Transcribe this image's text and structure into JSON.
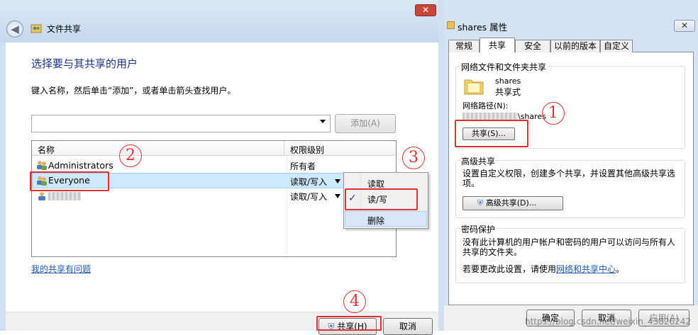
{
  "left_window": {
    "title": "文件共享",
    "close_glyph": "✕",
    "heading": "选择要与其共享的用户",
    "instruction": "键入名称，然后单击“添加”，或者单击箭头查找用户。",
    "add_button": "添加(A)",
    "columns": {
      "name": "名称",
      "permission": "权限级别"
    },
    "rows": [
      {
        "name": "Administrators",
        "permission": "所有者"
      },
      {
        "name": "Everyone",
        "permission": "读取/写入"
      },
      {
        "name": "",
        "permission": "读取/写入"
      }
    ],
    "context_menu": {
      "items": [
        "读取",
        "读/写",
        "删除"
      ],
      "checked": "读/写"
    },
    "problem_link": "我的共享有问题",
    "share_button": "共享(H)",
    "cancel_button": "取消"
  },
  "right_window": {
    "title": "shares 属性",
    "close_glyph": "✕",
    "tabs": [
      "常规",
      "共享",
      "安全",
      "以前的版本",
      "自定义"
    ],
    "active_tab": "共享",
    "network_group": {
      "title": "网络文件和文件夹共享",
      "folder_name": "shares",
      "folder_type": "共享式",
      "network_path_label": "网络路径(N):",
      "network_path_value": "\\shares",
      "share_button": "共享(S)..."
    },
    "advanced_group": {
      "title": "高级共享",
      "desc": "设置自定义权限，创建多个共享，并设置其他高级共享选项。",
      "button": "高级共享(D)..."
    },
    "password_group": {
      "title": "密码保护",
      "desc": "没有此计算机的用户帐户和密码的用户可以访问与所有人共享的文件夹。",
      "change_prefix": "若要更改此设置，请使用",
      "change_link": "网络和共享中心",
      "change_suffix": "。"
    },
    "buttons": {
      "ok": "确定",
      "cancel": "取消",
      "apply": "应用(A)"
    }
  },
  "annotations": [
    "1",
    "2",
    "3",
    "4"
  ],
  "watermark": "https://blog.csdn.net/weixin_43826242",
  "colors": {
    "annotation": "#e03030",
    "heading": "#1e3287",
    "link": "#1b57b3",
    "selection": "#cde8ff"
  }
}
